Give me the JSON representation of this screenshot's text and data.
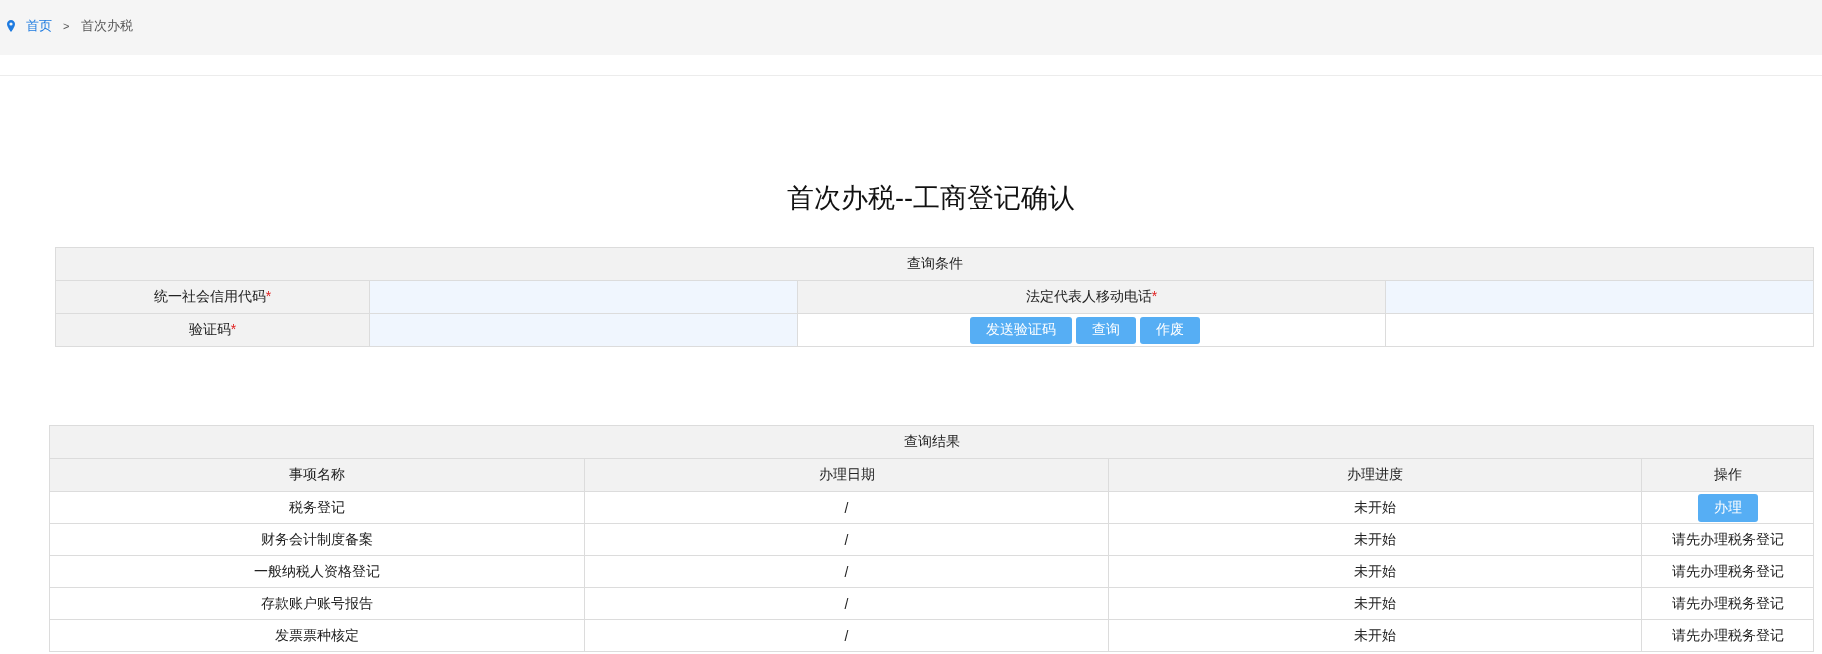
{
  "breadcrumb": {
    "items": [
      {
        "label": "首页",
        "kind": "link"
      },
      {
        "label": "首次办税",
        "kind": "current"
      }
    ],
    "separator": ">"
  },
  "title": "首次办税--工商登记确认",
  "query_form": {
    "caption": "查询条件",
    "fields": [
      {
        "label": "统一社会信用代码",
        "required_mark": "*"
      },
      {
        "label": "法定代表人移动电话",
        "required_mark": "*"
      },
      {
        "label": "验证码",
        "required_mark": "*"
      }
    ],
    "buttons": [
      "发送验证码",
      "查询",
      "作废"
    ]
  },
  "results": {
    "caption": "查询结果",
    "columns": [
      "事项名称",
      "办理日期",
      "办理进度",
      "操作"
    ],
    "rows": [
      {
        "item": "税务登记",
        "date": "/",
        "progress": "未开始",
        "action": {
          "kind": "button",
          "label": "办理"
        }
      },
      {
        "item": "财务会计制度备案",
        "date": "/",
        "progress": "未开始",
        "action": {
          "kind": "text",
          "label": "请先办理税务登记"
        }
      },
      {
        "item": "一般纳税人资格登记",
        "date": "/",
        "progress": "未开始",
        "action": {
          "kind": "text",
          "label": "请先办理税务登记"
        }
      },
      {
        "item": "存款账户账号报告",
        "date": "/",
        "progress": "未开始",
        "action": {
          "kind": "text",
          "label": "请先办理税务登记"
        }
      },
      {
        "item": "发票票种核定",
        "date": "/",
        "progress": "未开始",
        "action": {
          "kind": "text",
          "label": "请先办理税务登记"
        }
      }
    ]
  }
}
